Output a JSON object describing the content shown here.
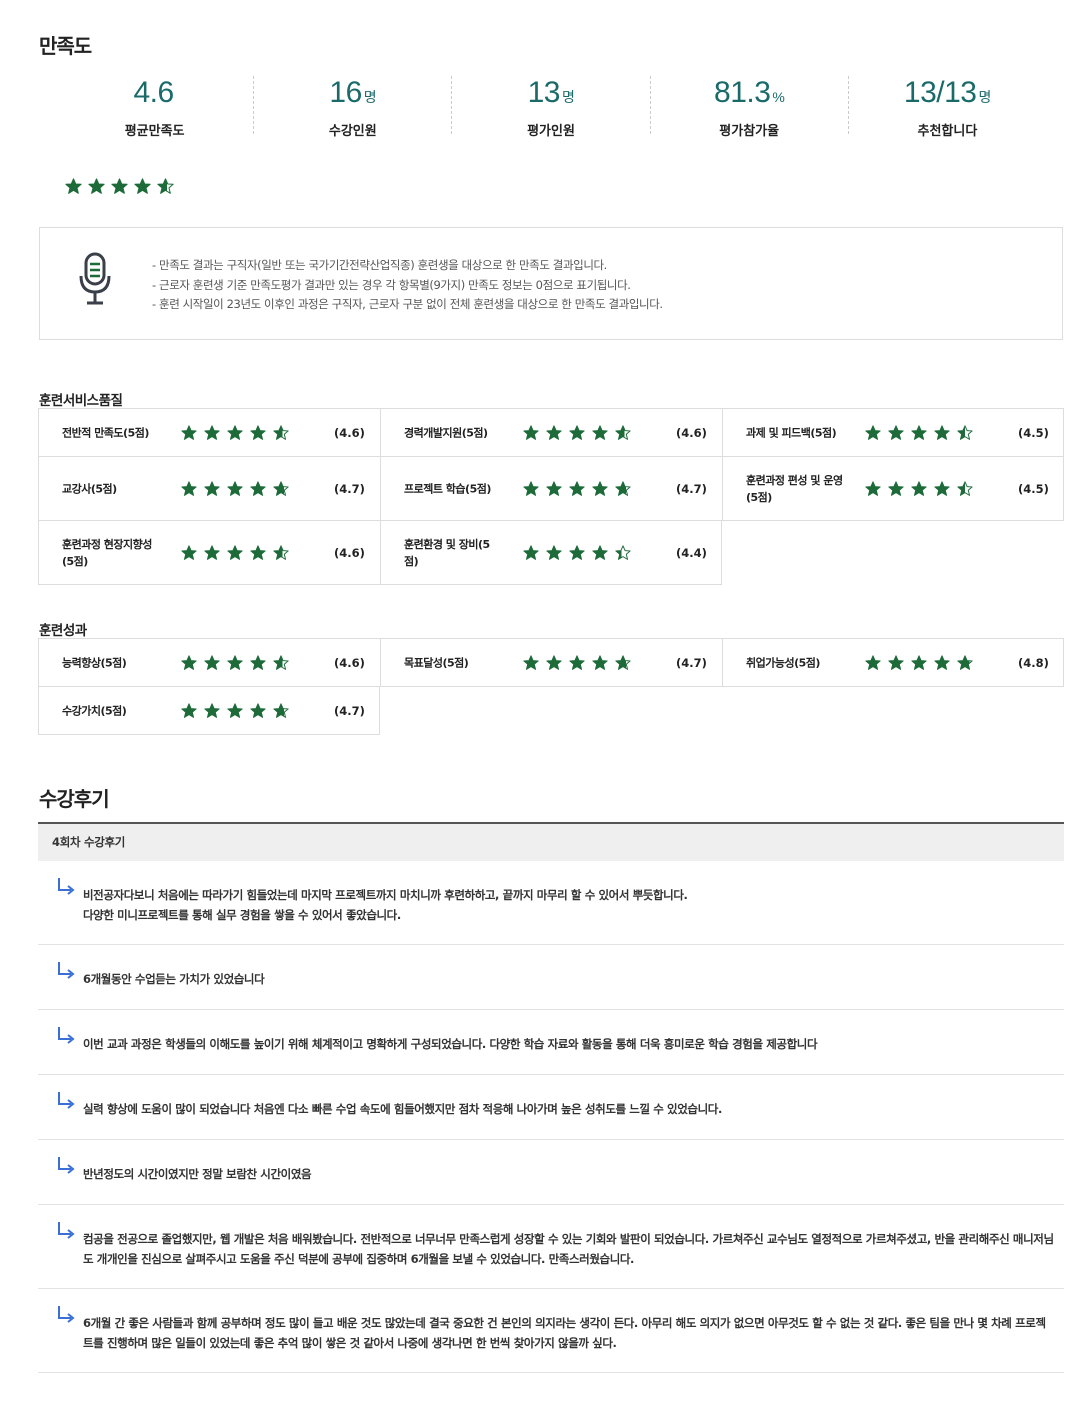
{
  "satisfaction": {
    "title": "만족도",
    "stats": [
      {
        "value": "4.6",
        "unit": "",
        "label": "평균만족도"
      },
      {
        "value": "16",
        "unit": "명",
        "label": "수강인원"
      },
      {
        "value": "13",
        "unit": "명",
        "label": "평가인원"
      },
      {
        "value": "81.3",
        "unit": "%",
        "label": "평가참가율"
      },
      {
        "value": "13/13",
        "unit": "명",
        "label": "추천합니다"
      }
    ],
    "overall_rating": 4.6,
    "star_color": "#1e6b3a",
    "notice": [
      "만족도 결과는 구직자(일반 또는 국가기간전략산업직종) 훈련생을 대상으로 한 만족도 결과입니다.",
      "근로자 훈련생 기준 만족도평가 결과만 있는 경우 각 항목별(9가지) 만족도 정보는 0점으로 표기됩니다.",
      "훈련 시작일이 23년도 이후인 과정은 구직자, 근로자 구분 없이 전체 훈련생을 대상으로 한 만족도 결과입니다."
    ]
  },
  "service_quality": {
    "title": "훈련서비스품질",
    "items": [
      {
        "name": "전반적 만족도(5점)",
        "rating": 4.6,
        "score": "(4.6)"
      },
      {
        "name": "경력개발지원(5점)",
        "rating": 4.6,
        "score": "(4.6)"
      },
      {
        "name": "과제 및 피드백(5점)",
        "rating": 4.5,
        "score": "(4.5)"
      },
      {
        "name": "교강사(5점)",
        "rating": 4.7,
        "score": "(4.7)"
      },
      {
        "name": "프로젝트 학습(5점)",
        "rating": 4.7,
        "score": "(4.7)"
      },
      {
        "name": "훈련과정 편성 및 운영(5점)",
        "rating": 4.5,
        "score": "(4.5)"
      },
      {
        "name": "훈련과정 현장지향성(5점)",
        "rating": 4.6,
        "score": "(4.6)"
      },
      {
        "name": "훈련환경 및 장비(5점)",
        "rating": 4.4,
        "score": "(4.4)"
      }
    ]
  },
  "outcomes": {
    "title": "훈련성과",
    "items": [
      {
        "name": "능력향상(5점)",
        "rating": 4.6,
        "score": "(4.6)"
      },
      {
        "name": "목표달성(5점)",
        "rating": 4.7,
        "score": "(4.7)"
      },
      {
        "name": "취업가능성(5점)",
        "rating": 4.8,
        "score": "(4.8)"
      },
      {
        "name": "수강가치(5점)",
        "rating": 4.7,
        "score": "(4.7)"
      }
    ]
  },
  "reviews": {
    "title": "수강후기",
    "group_label": "4회차 수강후기",
    "items": [
      "비전공자다보니 처음에는 따라가기 힘들었는데 마지막 프로젝트까지 마치니까 후련하하고, 끝까지 마무리 할 수 있어서 뿌듯합니다.\n다양한 미니프로젝트를 통해 실무 경험을 쌓을 수 있어서 좋았습니다.",
      "6개월동안 수업듣는 가치가 있었습니다",
      "이번 교과 과정은 학생들의 이해도를 높이기 위해 체계적이고 명확하게 구성되었습니다. 다양한 학습 자료와 활동을 통해 더욱 흥미로운 학습 경험을 제공합니다",
      "실력 향상에 도움이 많이 되었습니다 처음엔 다소 빠른 수업 속도에 힘들어했지만 점차 적응해 나아가며 높은 성취도를 느낄 수 있었습니다.",
      "반년정도의 시간이였지만 정말 보람찬 시간이였음",
      "컴공을 전공으로 졸업했지만, 웹 개발은 처음 배워봤습니다. 전반적으로 너무너무 만족스럽게 성장할 수 있는 기회와 발판이 되었습니다. 가르쳐주신 교수님도 열정적으로 가르쳐주셨고, 반을 관리해주신 매니저님도 개개인을 진심으로 살펴주시고 도움을 주신 덕분에 공부에 집중하며 6개월을 보낼 수 있었습니다. 만족스러웠습니다.",
      "6개월 간 좋은 사람들과 함께 공부하며 정도 많이 들고 배운 것도 많았는데 결국 중요한 건 본인의 의지라는 생각이 든다. 아무리 해도 의지가 없으면 아무것도 할 수 없는 것 같다. 좋은 팀을 만나 몇 차례 프로젝트를 진행하며 많은 일들이 있었는데 좋은 추억 많이 쌓은 것 같아서 나중에 생각나면 한 번씩 찾아가지 않을까 싶다."
    ]
  }
}
